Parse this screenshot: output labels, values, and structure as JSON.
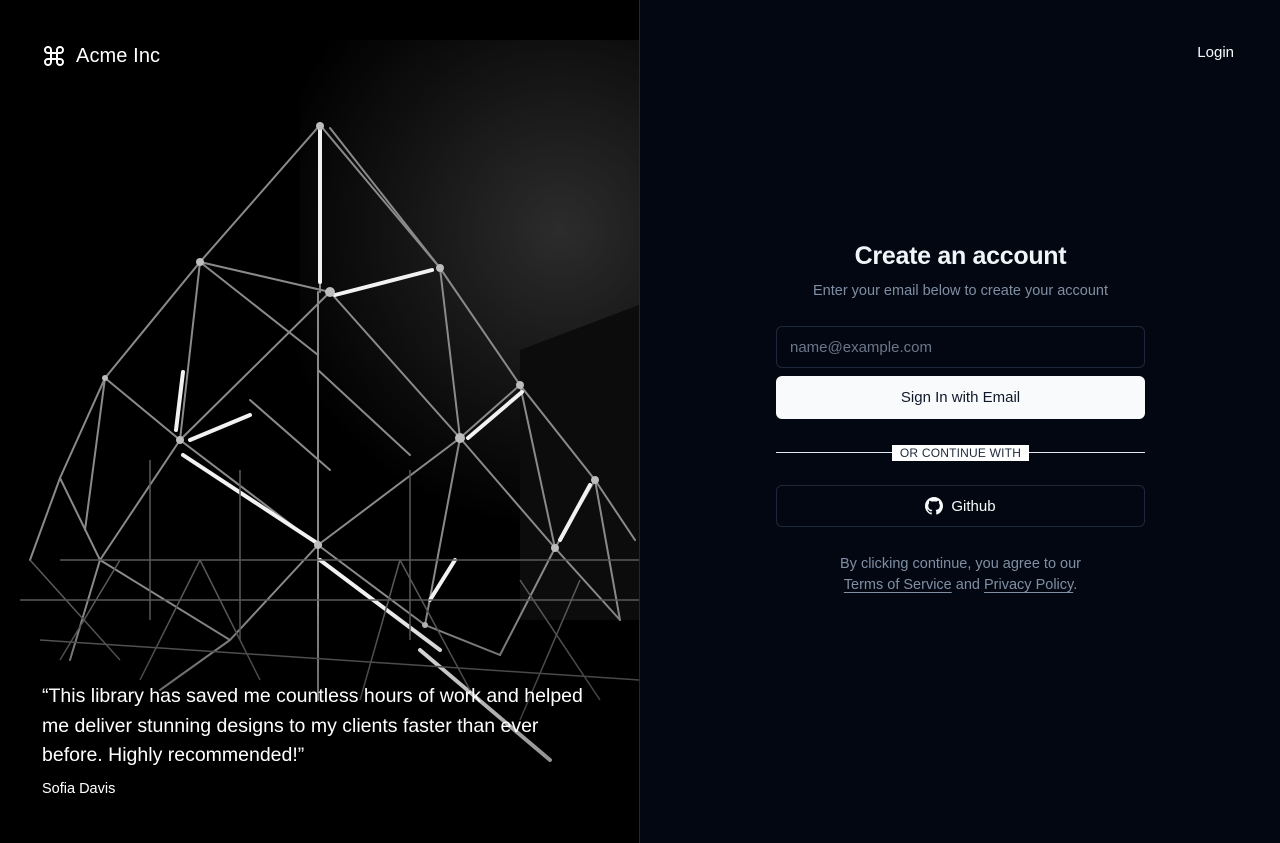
{
  "brand": {
    "name": "Acme Inc",
    "icon": "command-icon"
  },
  "testimonial": {
    "quote": "“This library has saved me countless hours of work and helped me deliver stunning designs to my clients faster than ever before. Highly recommended!”",
    "author": "Sofia Davis"
  },
  "header": {
    "login_label": "Login"
  },
  "form": {
    "title": "Create an account",
    "subtitle": "Enter your email below to create your account",
    "email_placeholder": "name@example.com",
    "email_value": "",
    "submit_label": "Sign In with Email",
    "divider_label": "OR CONTINUE WITH",
    "github_label": "Github",
    "github_icon": "github-icon"
  },
  "legal": {
    "prefix": "By clicking continue, you agree to our",
    "terms_label": "Terms of Service",
    "and": "and",
    "privacy_label": "Privacy Policy",
    "suffix": "."
  },
  "colors": {
    "background": "#030711",
    "left_panel": "#000000",
    "primary_button": "#f8fafc",
    "muted_text": "#7f8ea3",
    "border": "#1d283a"
  }
}
